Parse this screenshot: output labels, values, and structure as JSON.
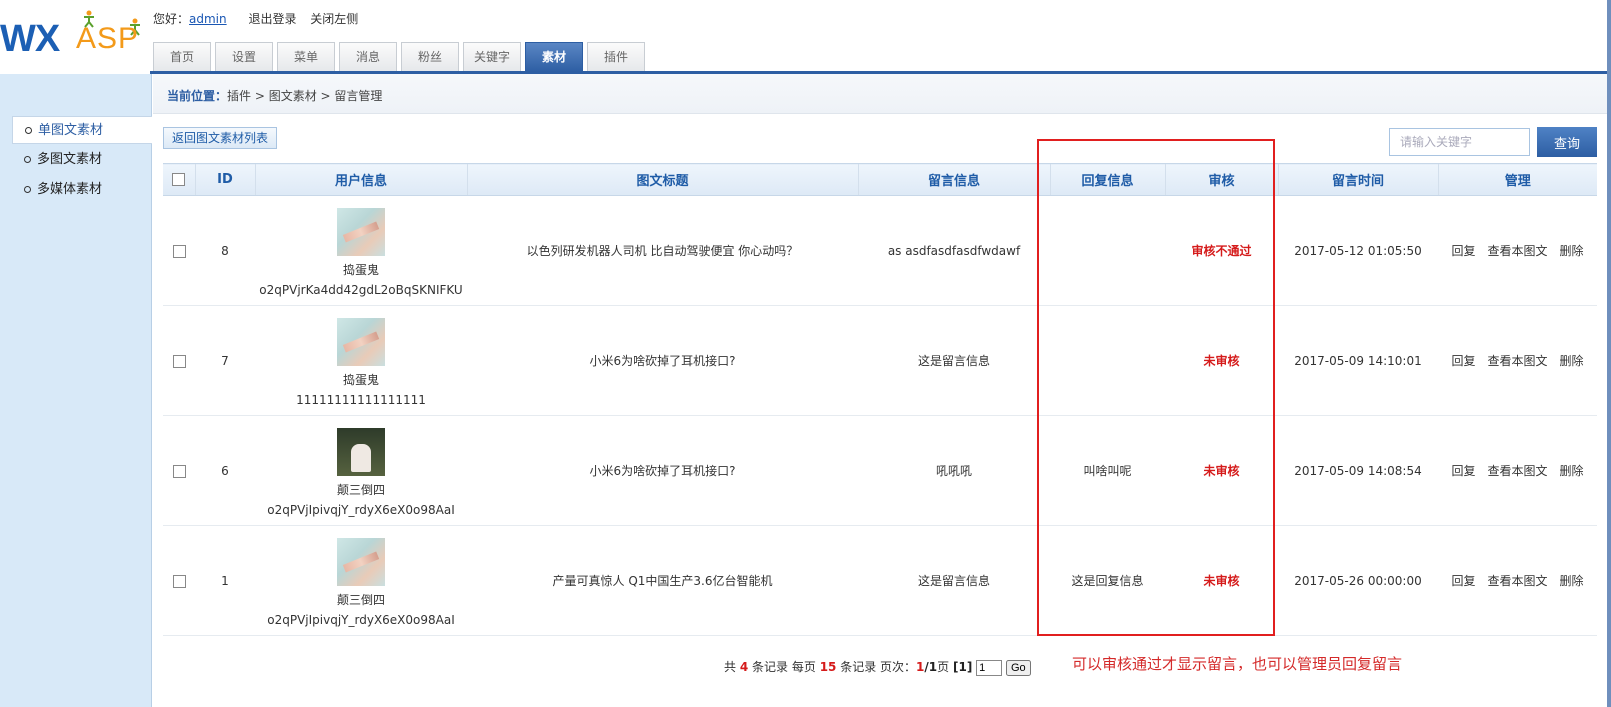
{
  "logo": {
    "text_left": "WX",
    "text_right": "ASP"
  },
  "userbar": {
    "greeting": "您好：",
    "username": "admin",
    "logout": "退出登录",
    "close_left": "关闭左侧"
  },
  "tabs": [
    {
      "label": "首页"
    },
    {
      "label": "设置"
    },
    {
      "label": "菜单"
    },
    {
      "label": "消息"
    },
    {
      "label": "粉丝"
    },
    {
      "label": "关键字"
    },
    {
      "label": "素材"
    },
    {
      "label": "插件"
    }
  ],
  "sidebar": {
    "items": [
      {
        "label": "单图文素材"
      },
      {
        "label": "多图文素材"
      },
      {
        "label": "多媒体素材"
      }
    ]
  },
  "breadcrumb": {
    "label": "当前位置：",
    "path": "插件 > 图文素材 > 留言管理"
  },
  "toolbar": {
    "back_label": "返回图文素材列表",
    "search_placeholder": "请输入关键字",
    "search_label": "查询"
  },
  "table": {
    "headers": {
      "id": "ID",
      "user": "用户信息",
      "title": "图文标题",
      "message": "留言信息",
      "reply": "回复信息",
      "review": "审核",
      "time": "留言时间",
      "manage": "管理"
    },
    "actions": {
      "reply": "回复",
      "view": "查看本图文",
      "delete": "删除"
    },
    "rows": [
      {
        "id": "8",
        "nick": "捣蛋鬼",
        "openid": "o2qPVjrKa4dd42gdL2oBqSKNIFKU",
        "avatar": "flower-avatar",
        "title": "以色列研发机器人司机 比自动驾驶便宜 你心动吗？",
        "message": "as asdfasdfasdfwdawf",
        "reply": "",
        "status": "审核不通过",
        "time": "2017-05-12 01:05:50"
      },
      {
        "id": "7",
        "nick": "捣蛋鬼",
        "openid": "11111111111111111",
        "avatar": "flower-avatar",
        "title": "小米6为啥砍掉了耳机接口?",
        "message": "这是留言信息",
        "reply": "",
        "status": "未审核",
        "time": "2017-05-09 14:10:01"
      },
      {
        "id": "6",
        "nick": "颠三倒四",
        "openid": "o2qPVjIpivqjY_rdyX6eX0o98AaI",
        "avatar": "couple-avatar",
        "title": "小米6为啥砍掉了耳机接口?",
        "message": "吼吼吼",
        "reply": "叫啥叫呢",
        "status": "未审核",
        "time": "2017-05-09 14:08:54"
      },
      {
        "id": "1",
        "nick": "颠三倒四",
        "openid": "o2qPVjIpivqjY_rdyX6eX0o98AaI",
        "avatar": "flower-avatar",
        "title": "产量可真惊人 Q1中国生产3.6亿台智能机",
        "message": "这是留言信息",
        "reply": "这是回复信息",
        "status": "未审核",
        "time": "2017-05-26 00:00:00"
      }
    ]
  },
  "pager": {
    "p1": "共",
    "total": "4",
    "p2": "条记录 每页",
    "per_page": "15",
    "p3": "条记录 页次：",
    "current": "1",
    "slash": "/",
    "pages": "1",
    "p4": "页",
    "current_bracket": "[1]",
    "input_value": "1",
    "go": "Go"
  },
  "annotation": "可以审核通过才显示留言，也可以管理员回复留言",
  "colors": {
    "accent": "#2d5ea3",
    "status_red": "#d51b1b",
    "annotation_red": "#e11f1f"
  }
}
